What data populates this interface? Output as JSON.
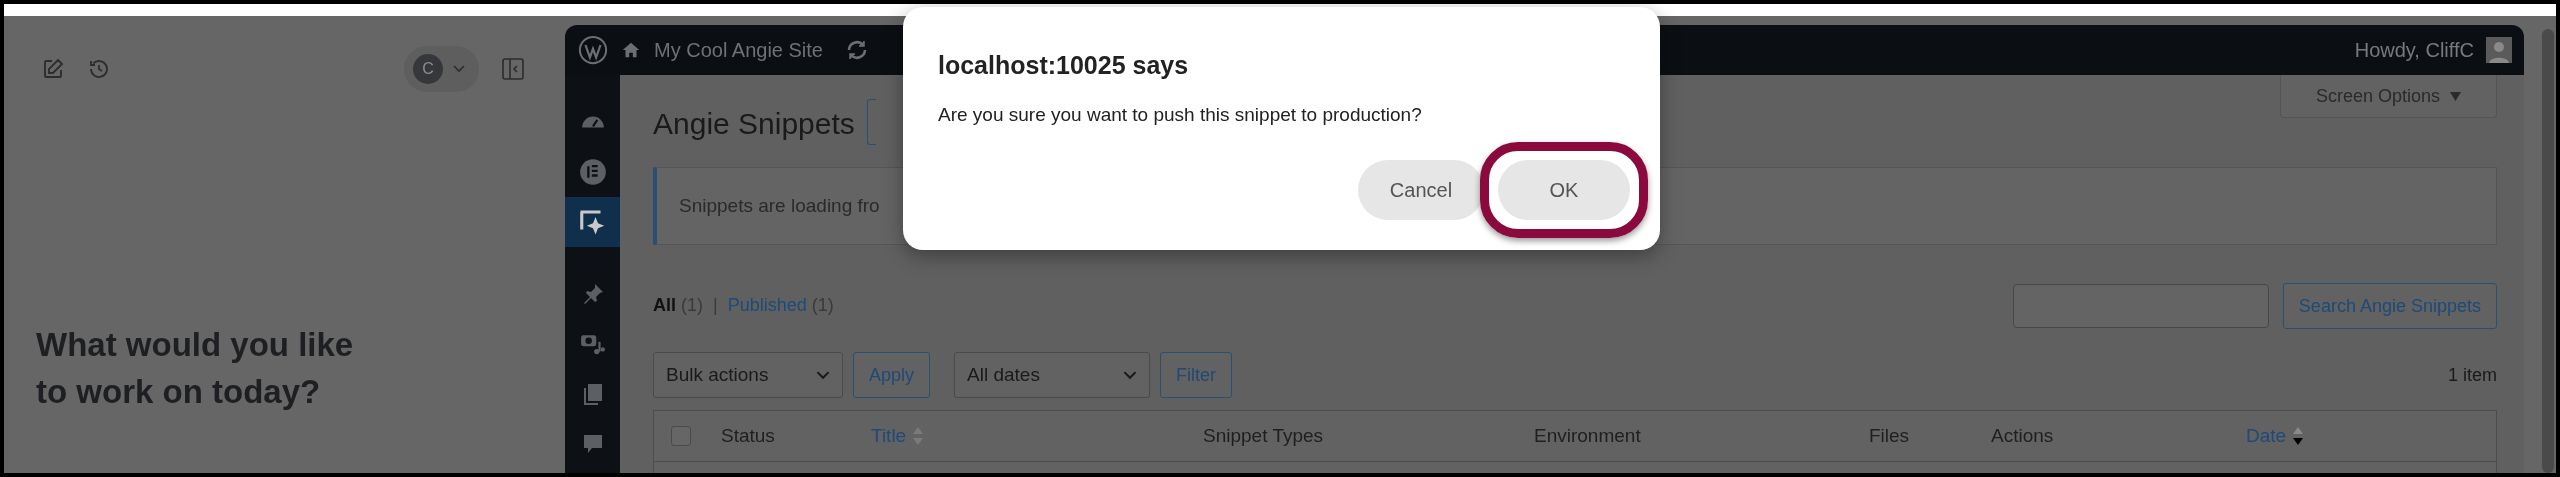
{
  "left_panel": {
    "avatar_initial": "C",
    "heading": "What would you like to work on today?"
  },
  "admin_bar": {
    "site_name": "My Cool Angie Site",
    "greeting": "Howdy, CliffC"
  },
  "sidebar": {
    "items": [
      {
        "kind": "gauge",
        "selected": false
      },
      {
        "kind": "elementor",
        "selected": false
      },
      {
        "kind": "sparkle",
        "selected": true
      },
      {
        "kind": "pin",
        "selected": false
      },
      {
        "kind": "media",
        "selected": false
      },
      {
        "kind": "pages",
        "selected": false
      },
      {
        "kind": "comments",
        "selected": false
      }
    ]
  },
  "page": {
    "title": "Angie Snippets",
    "screen_options": "Screen Options",
    "notice": "Snippets are loading fro",
    "filters": [
      {
        "label": "All",
        "count": "(1)",
        "selected": true
      },
      {
        "label": "Published",
        "count": "(1)",
        "selected": false
      }
    ],
    "filter_separator": "|",
    "search_button": "Search Angie Snippets",
    "bulk_actions": "Bulk actions",
    "apply": "Apply",
    "dates": "All dates",
    "filter": "Filter",
    "item_count": "1 item",
    "columns": [
      {
        "label": "Status",
        "sortable": false
      },
      {
        "label": "Title",
        "sortable": true,
        "sorted": false
      },
      {
        "label": "Snippet Types",
        "sortable": false
      },
      {
        "label": "Environment",
        "sortable": false
      },
      {
        "label": "Files",
        "sortable": false
      },
      {
        "label": "Actions",
        "sortable": false
      },
      {
        "label": "Date",
        "sortable": true,
        "sorted": true
      }
    ],
    "select_all_checked": false
  },
  "dialog": {
    "title": "localhost:10025 says",
    "message": "Are you sure you want to push this snippet to production?",
    "buttons": [
      {
        "label": "Cancel",
        "highlighted": false
      },
      {
        "label": "OK",
        "highlighted": true
      }
    ]
  }
}
